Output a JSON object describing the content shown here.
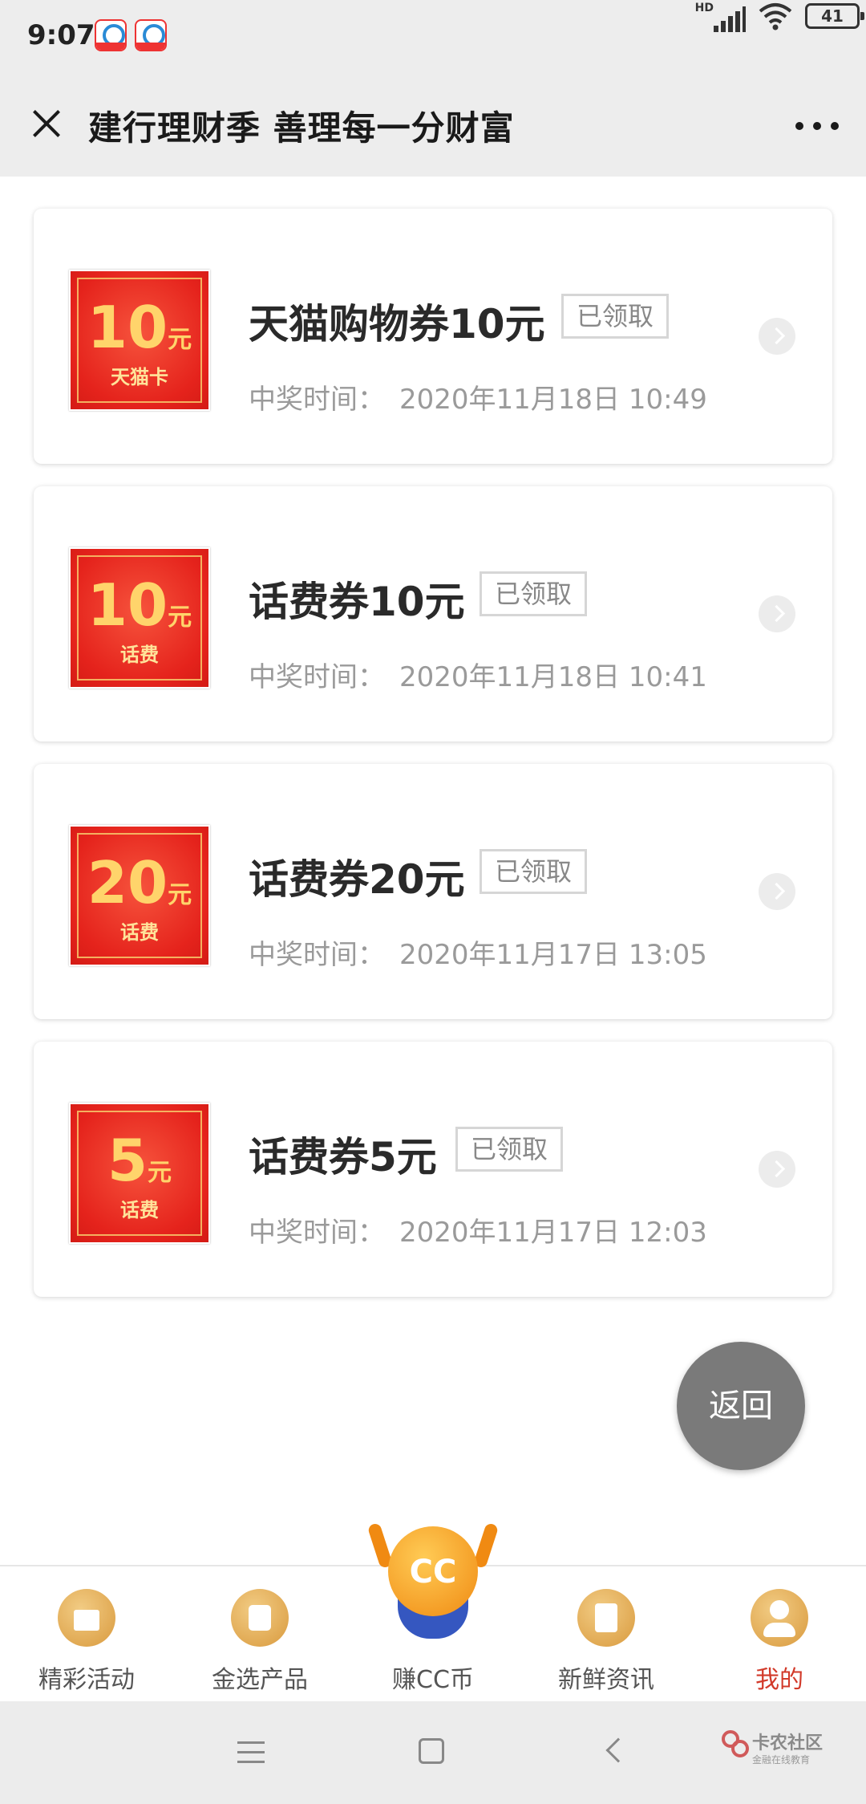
{
  "status_bar": {
    "time": "9:07",
    "network_label": "HD",
    "battery": "41"
  },
  "header": {
    "title": "建行理财季 善理每一分财富"
  },
  "prizes": [
    {
      "coupon_amount": "10",
      "coupon_unit": "元",
      "coupon_sub": "天猫卡",
      "title": "天猫购物券10元",
      "status": "已领取",
      "time_label": "中奖时间：",
      "time": "2020年11月18日 10:49"
    },
    {
      "coupon_amount": "10",
      "coupon_unit": "元",
      "coupon_sub": "话费",
      "title": "话费券10元",
      "status": "已领取",
      "time_label": "中奖时间：",
      "time": "2020年11月18日 10:41"
    },
    {
      "coupon_amount": "20",
      "coupon_unit": "元",
      "coupon_sub": "话费",
      "title": "话费券20元",
      "status": "已领取",
      "time_label": "中奖时间：",
      "time": "2020年11月17日 13:05"
    },
    {
      "coupon_amount": "5",
      "coupon_unit": "元",
      "coupon_sub": "话费",
      "title": "话费券5元",
      "status": "已领取",
      "time_label": "中奖时间：",
      "time": "2020年11月17日 12:03"
    }
  ],
  "back_button": "返回",
  "tabs": [
    {
      "label": "精彩活动",
      "icon": "gift-icon"
    },
    {
      "label": "金选产品",
      "icon": "bag-icon"
    },
    {
      "label": "赚CC币",
      "icon": "mascot-icon",
      "mascot_text": "CC"
    },
    {
      "label": "新鲜资讯",
      "icon": "news-icon"
    },
    {
      "label": "我的",
      "icon": "user-icon",
      "active": true
    }
  ],
  "watermark": {
    "name": "卡农社区",
    "sub": "金融在线教育"
  },
  "colors": {
    "accent_active": "#d23a2a",
    "coupon_red": "#e5231c",
    "tab_icon_gold": "#d99a3e"
  }
}
